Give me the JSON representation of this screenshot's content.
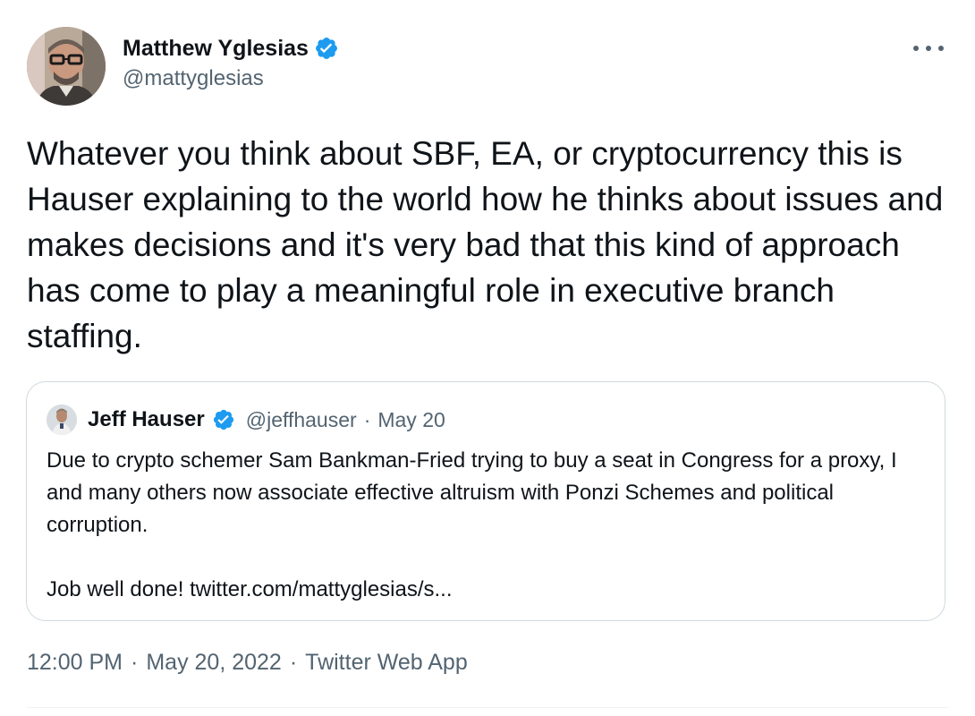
{
  "author": {
    "display_name": "Matthew Yglesias",
    "handle": "@mattyglesias",
    "verified": true
  },
  "tweet": {
    "text": "Whatever you think about SBF, EA, or cryptocurrency this is Hauser explaining to the world how he thinks about issues and makes decisions and it's very bad that this kind of approach has come to play a meaningful role in executive branch staffing."
  },
  "quoted_tweet": {
    "display_name": "Jeff Hauser",
    "handle": "@jeffhauser",
    "separator": "·",
    "date": "May 20",
    "verified": true,
    "paragraph_1": "Due to crypto schemer Sam Bankman-Fried trying to buy a seat in Congress for a proxy, I and many others now associate effective altruism with Ponzi Schemes and political corruption.",
    "paragraph_2": "Job well done! twitter.com/mattyglesias/s..."
  },
  "meta": {
    "time": "12:00 PM",
    "separator": "·",
    "date": "May 20, 2022",
    "source": "Twitter Web App"
  },
  "colors": {
    "verified_blue": "#1d9bf0",
    "text_primary": "#0f1419",
    "text_secondary": "#536471",
    "border": "#cfd9de"
  },
  "icons": {
    "more": "more-options-icon",
    "verified": "verified-badge-icon"
  }
}
